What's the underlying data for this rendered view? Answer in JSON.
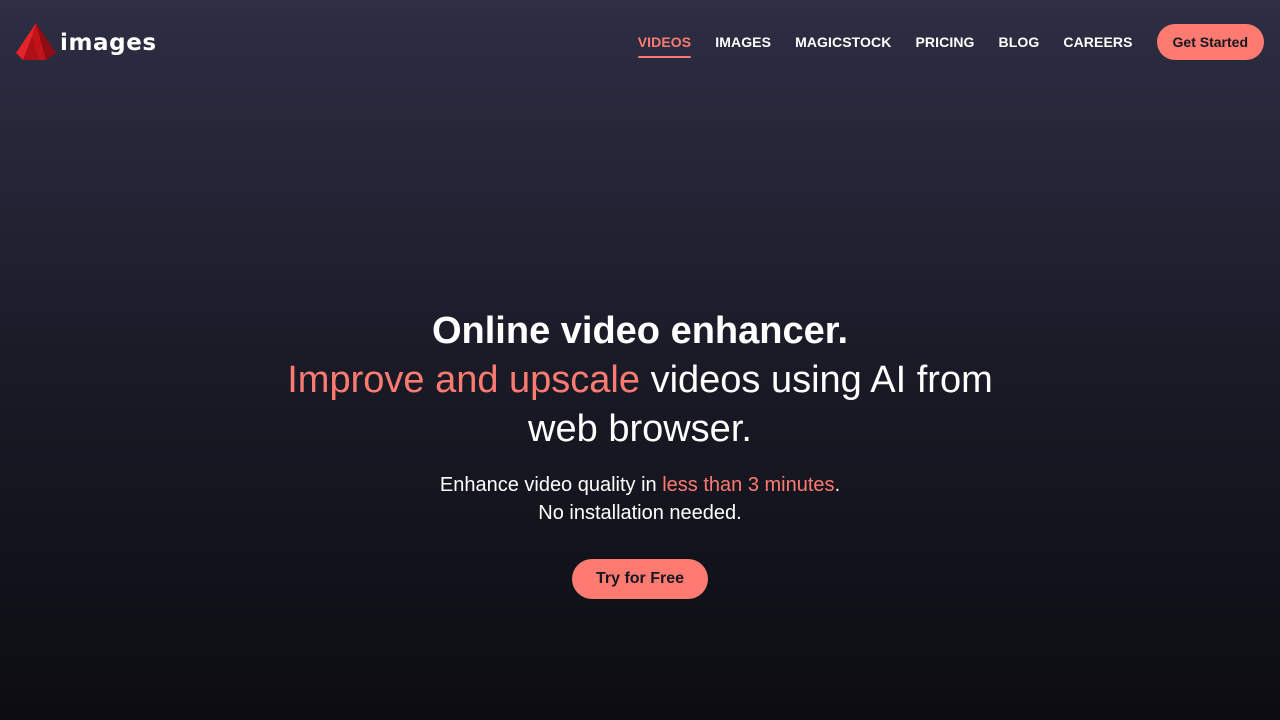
{
  "brand": {
    "name": "images",
    "logo_icon": "red-triangle-logo-icon"
  },
  "nav": {
    "items": [
      {
        "label": "VIDEOS",
        "active": true
      },
      {
        "label": "IMAGES",
        "active": false
      },
      {
        "label": "MAGICSTOCK",
        "active": false
      },
      {
        "label": "PRICING",
        "active": false
      },
      {
        "label": "BLOG",
        "active": false
      },
      {
        "label": "CAREERS",
        "active": false
      }
    ],
    "cta_label": "Get Started"
  },
  "hero": {
    "title": "Online video enhancer.",
    "subtitle_accent": "Improve and upscale",
    "subtitle_rest": " videos using AI from web browser.",
    "desc_before": "Enhance video quality in ",
    "desc_accent": "less than 3 minutes",
    "desc_after": ".",
    "desc_line2": "No installation needed.",
    "cta_label": "Try for Free"
  },
  "colors": {
    "accent": "#ff7b72",
    "background_top": "#2e2e44",
    "background_bottom": "#0c0c11",
    "logo_red": "#d7141e"
  }
}
